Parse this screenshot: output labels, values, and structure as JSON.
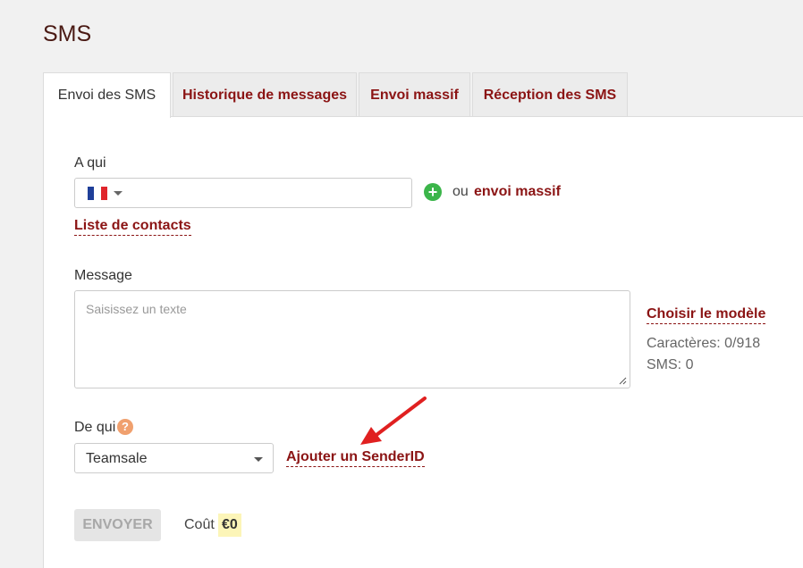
{
  "page": {
    "title": "SMS"
  },
  "tabs": [
    {
      "label": "Envoi des SMS",
      "active": true
    },
    {
      "label": "Historique de messages",
      "active": false
    },
    {
      "label": "Envoi massif",
      "active": false
    },
    {
      "label": "Réception des SMS",
      "active": false
    }
  ],
  "recipient": {
    "label": "A qui",
    "country_flag_icon": "france-flag-icon",
    "phone_value": "",
    "or_text": "ou",
    "mass_send_link": "envoi massif",
    "contacts_link": "Liste de contacts"
  },
  "message": {
    "label": "Message",
    "placeholder": "Saisissez un texte",
    "template_link": "Choisir le modèle",
    "characters": "Caractères: 0/918",
    "sms_count": "SMS: 0"
  },
  "sender": {
    "label": "De qui",
    "selected": "Teamsale",
    "add_sender_link": "Ajouter un SenderID"
  },
  "actions": {
    "send_label": "ENVOYER",
    "cost_label": "Coût",
    "cost_value": "€0"
  },
  "colors": {
    "accent": "#8b1414",
    "title": "#4a1a14",
    "add_icon": "#3bb54a",
    "help_icon": "#f0a06e",
    "annotation_arrow": "#e02020",
    "cost_highlight": "#fcf5b8"
  }
}
